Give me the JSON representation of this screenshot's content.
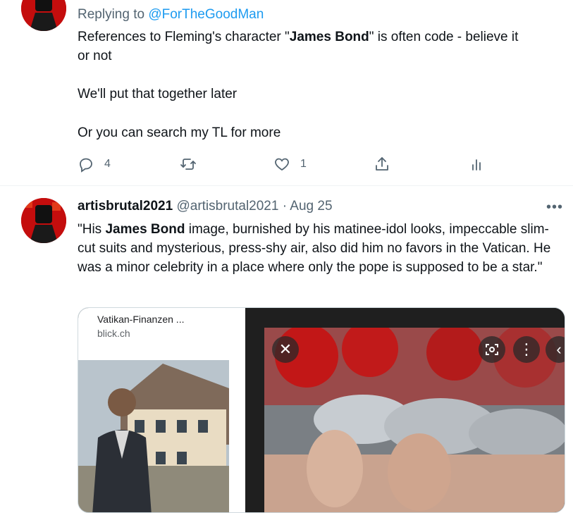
{
  "reply_tweet": {
    "replying_prefix": "Replying to",
    "replying_handle": "@ForTheGoodMan",
    "text_part1": "References to Fleming's character \"",
    "text_bold": "James Bond",
    "text_part2": "\"  is often code - believe it",
    "text_line2": "or not",
    "paragraph2": "We'll put that together later",
    "paragraph3": "Or you can search my TL for more",
    "actions": {
      "reply_count": "4",
      "retweet_count": "",
      "like_count": "1"
    }
  },
  "main_tweet": {
    "display_name": "artisbrutal2021",
    "handle": "@artisbrutal2021",
    "separator": "·",
    "date": "Aug 25",
    "more_glyph": "•••",
    "text_part1": "\"His ",
    "text_bold": "James Bond",
    "text_part2": " image, burnished by his matinee-idol looks, impeccable slim-cut suits and mysterious, press-shy air, also did him no favors in the Vatican. He was a minor celebrity in a place where only the pope is supposed to be a star.\"",
    "media": {
      "card_title": "Vatikan-Finanzen ...",
      "card_source": "blick.ch",
      "close_glyph": "✕",
      "kebab_glyph": "⋮",
      "chevron_glyph": "‹"
    }
  },
  "colors": {
    "link": "#1d9bf0",
    "secondary_text": "#536471",
    "avatar_red": "#c40d0d"
  }
}
